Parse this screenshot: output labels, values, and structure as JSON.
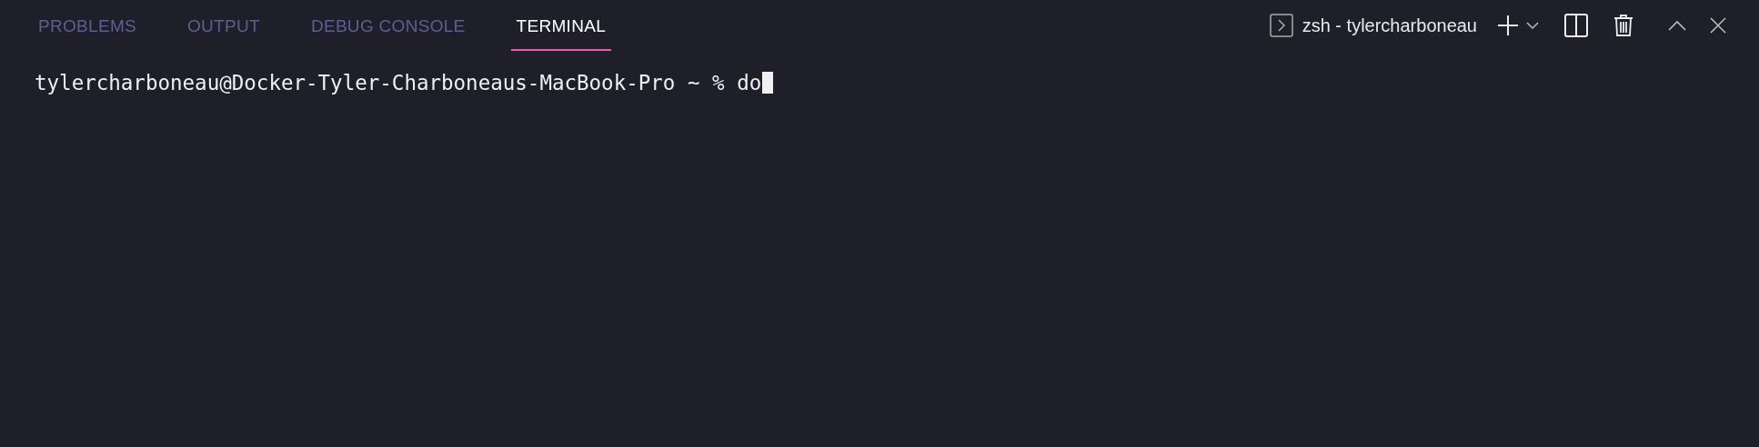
{
  "tabs": [
    {
      "label": "PROBLEMS",
      "selected": false
    },
    {
      "label": "OUTPUT",
      "selected": false
    },
    {
      "label": "DEBUG CONSOLE",
      "selected": false
    },
    {
      "label": "TERMINAL",
      "selected": true
    }
  ],
  "terminal_selector": {
    "label": "zsh - tylercharboneau"
  },
  "terminal": {
    "prompt": "tylercharboneau@Docker-Tyler-Charboneaus-MacBook-Pro ~ %",
    "input": "do"
  }
}
